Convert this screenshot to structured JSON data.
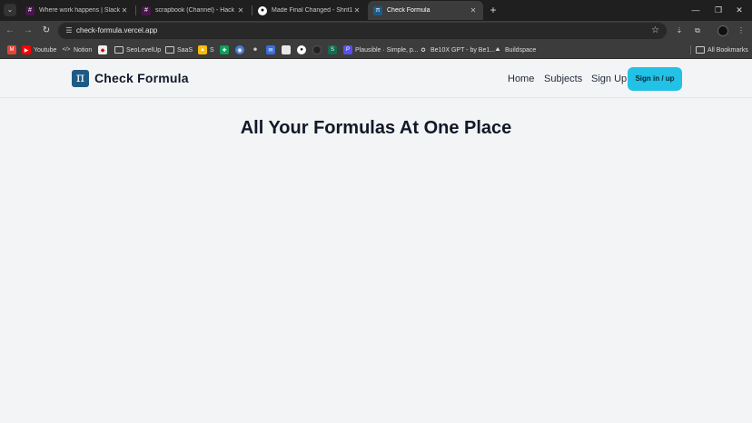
{
  "browser": {
    "tabs": [
      {
        "title": "Where work happens | Slack",
        "favicon": "slack-icon",
        "active": false
      },
      {
        "title": "scrapbook (Channel) - Hack Cl",
        "favicon": "slack-icon",
        "active": false
      },
      {
        "title": "Made Final Changed - Shrit140",
        "favicon": "github-icon",
        "active": false
      },
      {
        "title": "Check Formula",
        "favicon": "pi-icon",
        "active": true
      }
    ],
    "url": "check-formula.vercel.app",
    "bookmarks": [
      {
        "label": "",
        "icon": "gmail-icon"
      },
      {
        "label": "Youtube",
        "icon": "youtube-icon"
      },
      {
        "label": "Notion",
        "icon": "code-icon"
      },
      {
        "label": "",
        "icon": "app-icon"
      },
      {
        "label": "SeoLevelUp",
        "icon": "folder-icon"
      },
      {
        "label": "SaaS",
        "icon": "folder-icon"
      },
      {
        "label": "S",
        "icon": "drive-icon"
      },
      {
        "label": "",
        "icon": "sheets-icon"
      },
      {
        "label": "",
        "icon": "globe-icon"
      },
      {
        "label": "",
        "icon": "robot-icon"
      },
      {
        "label": "",
        "icon": "chat-icon"
      },
      {
        "label": "",
        "icon": "doc-icon"
      },
      {
        "label": "",
        "icon": "github-icon"
      },
      {
        "label": "",
        "icon": "circle-icon"
      },
      {
        "label": "",
        "icon": "s-icon"
      },
      {
        "label": "Plausible · Simple, p...",
        "icon": "plausible-icon"
      },
      {
        "label": "Be10X GPT - by Be1...",
        "icon": "gpt-icon"
      },
      {
        "label": "Buildspace",
        "icon": "buildspace-icon"
      }
    ],
    "all_bookmarks": "All Bookmarks"
  },
  "site": {
    "logo_symbol": "π",
    "brand": "Check Formula",
    "nav": {
      "home": "Home",
      "subjects": "Subjects",
      "signup": "Sign Up",
      "signin": "Sign in / up"
    },
    "hero_title": "All Your Formulas At One Place"
  },
  "colors": {
    "accent": "#22c1e6",
    "logo_bg": "#1e5a85",
    "page_bg": "#f3f4f6"
  }
}
